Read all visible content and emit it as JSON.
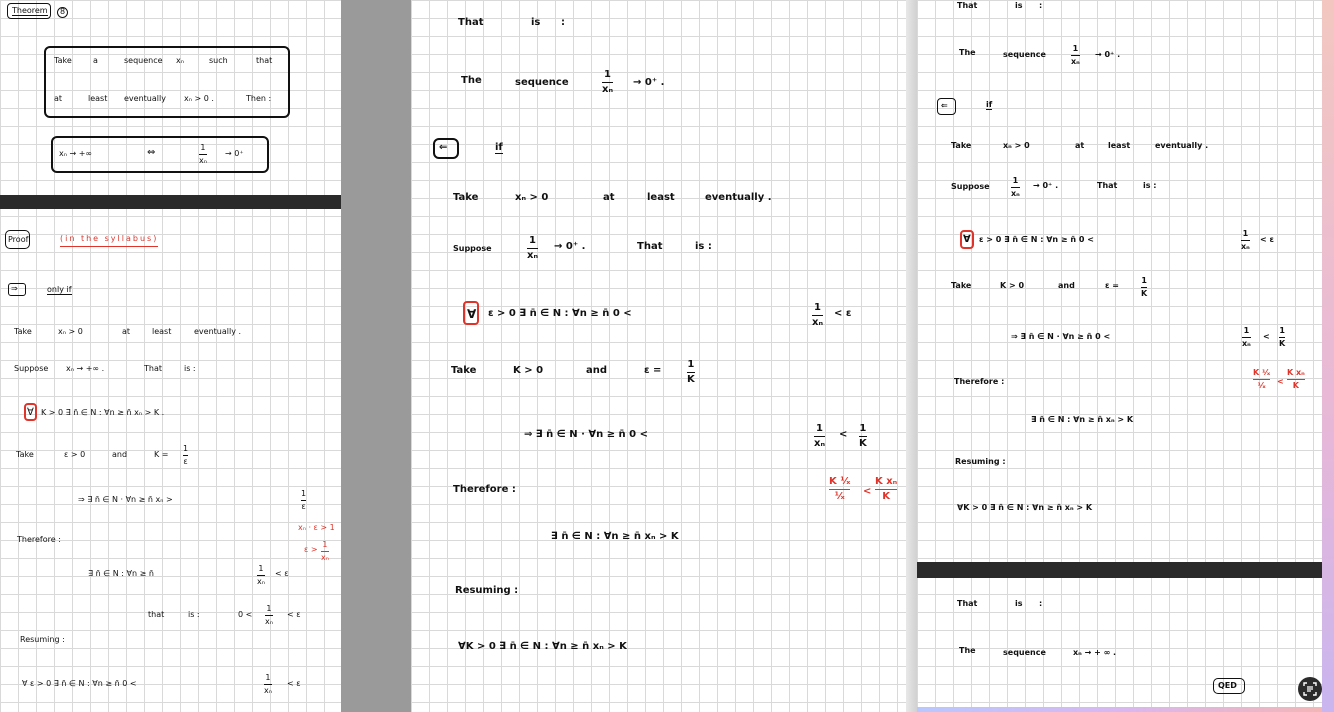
{
  "left": {
    "theorem_label": "Theorem",
    "theorem_num": "8",
    "box1_row1": [
      "Take",
      "a",
      "sequence",
      "xₙ",
      "such",
      "that"
    ],
    "box1_row2": [
      "at",
      "least",
      "eventually",
      "xₙ > 0 .",
      "Then :"
    ],
    "box2_lhs": "xₙ → +∞",
    "box2_iff": "⇔",
    "box2_num": "1",
    "box2_den": "xₙ",
    "box2_rhs": "→ 0⁺",
    "proof_label": "Proof",
    "proof_note": "(in the syllabus)",
    "only_if_arrow": "⇒",
    "only_if_label": "only if",
    "line_take": [
      "Take",
      "xₙ > 0",
      "at",
      "least",
      "eventually ."
    ],
    "line_suppose": [
      "Suppose",
      "xₙ → +∞ .",
      "That",
      "is :"
    ],
    "forall_sym": "∀",
    "line_forall": "K > 0     ∃ n̄ ∈ N  :  ∀n ≥ n̄        xₙ > K .",
    "line_take2": [
      "Take",
      "ε > 0",
      "and",
      "K ="
    ],
    "take2_num": "1",
    "take2_den": "ε",
    "line_imp": "⇒     ∃ n̄ ∈ N  ·  ∀n ≥ n̄        xₙ >",
    "imp_num": "1",
    "imp_den": "ε",
    "red1": "xₙ · ε > 1",
    "red2_pre": "ε >",
    "red2_num": "1",
    "red2_den": "xₙ",
    "therefore": "Therefore :",
    "line_there": "∃ n̄ ∈ N :    ∀n ≥ n̄",
    "there_num": "1",
    "there_den": "xₙ",
    "there_rhs": "< ε",
    "that_is": [
      "that",
      "is :",
      "0 <"
    ],
    "thatis_num": "1",
    "thatis_den": "xₙ",
    "thatis_rhs": "< ε",
    "resuming": "Resuming :",
    "line_resume": "∀ ε > 0     ∃ n̄ ∈ N :    ∀n ≥ n̄          0 <",
    "resume_num": "1",
    "resume_den": "xₙ",
    "resume_rhs": "< ε"
  },
  "mid": {
    "that_is": [
      "That",
      "is",
      ":"
    ],
    "seq": [
      "The",
      "sequence"
    ],
    "seq_num": "1",
    "seq_den": "xₙ",
    "seq_rhs": "→ 0⁺ .",
    "if_arrow": "⇐",
    "if_label": "if",
    "take": [
      "Take",
      "xₙ > 0",
      "at",
      "least",
      "eventually ."
    ],
    "suppose": [
      "Suppose"
    ],
    "sup_num": "1",
    "sup_den": "xₙ",
    "sup_rhs": "→  0⁺ .",
    "sup_tail": [
      "That",
      "is :"
    ],
    "forall_sym": "∀",
    "forall_line": "ε > 0      ∃ n̄ ∈ N  :  ∀n ≥ n̄            0 <",
    "forall_num": "1",
    "forall_den": "xₙ",
    "forall_rhs": "< ε",
    "take2": [
      "Take",
      "K > 0",
      "and",
      "ε ="
    ],
    "take2_num": "1",
    "take2_den": "K",
    "imp_line": "⇒    ∃ n̄ ∈ N  ·  ∀n ≥ n̄          0 <",
    "imp_num1": "1",
    "imp_den1": "xₙ",
    "imp_mid": "<",
    "imp_num2": "1",
    "imp_den2": "K",
    "therefore": "Therefore :",
    "red_left_num": "K ¹⁄ₓ",
    "red_left_den": "¹⁄ₓ",
    "red_lt": "<",
    "red_right_num": "K xₙ",
    "red_right_den": "K",
    "there_line": "∃ n̄ ∈ N :     ∀n ≥ n̄            xₙ > K",
    "resuming": "Resuming :",
    "resume_line": "∀K > 0      ∃ n̄ ∈ N :     ∀n ≥ n̄            xₙ > K"
  },
  "right": {
    "that_is": [
      "That",
      "is",
      ":"
    ],
    "seq": [
      "The",
      "sequence"
    ],
    "seq_num": "1",
    "seq_den": "xₙ",
    "seq_rhs": "→ 0⁺ .",
    "if_arrow": "⇐",
    "if_label": "if",
    "take": [
      "Take",
      "xₙ > 0",
      "at",
      "least",
      "eventually ."
    ],
    "suppose": "Suppose",
    "sup_num": "1",
    "sup_den": "xₙ",
    "sup_rhs": "→ 0⁺ .",
    "sup_tail": [
      "That",
      "is :"
    ],
    "forall_sym": "∀",
    "forall_line": "ε > 0       ∃ n̄ ∈ N  :  ∀n ≥ n̄           0 <",
    "forall_num": "1",
    "forall_den": "xₙ",
    "forall_rhs": "< ε",
    "take2": [
      "Take",
      "K > 0",
      "and",
      "ε ="
    ],
    "take2_num": "1",
    "take2_den": "K",
    "imp_line": "⇒    ∃ n̄ ∈ N  ·  ∀n ≥ n̄          0 <",
    "imp_num1": "1",
    "imp_den1": "xₙ",
    "imp_mid": "<",
    "imp_num2": "1",
    "imp_den2": "K",
    "therefore": "Therefore :",
    "red_a": "K ¹⁄ₓ",
    "red_a_den": "¹⁄ₓ",
    "red_b": "K xₙ",
    "red_b_den": "K",
    "there_line": "∃ n̄ ∈ N :     ∀n ≥ n̄           xₙ > K",
    "resuming": "Resuming :",
    "resume_line": "∀K > 0     ∃ n̄ ∈ N :     ∀n ≥ n̄           xₙ > K",
    "that_is2": [
      "That",
      "is",
      ":"
    ],
    "seq2": [
      "The",
      "sequence",
      "xₙ → + ∞ ."
    ],
    "qed": "QED"
  },
  "fab_icon": "scan-text-icon",
  "accent_red": "#e0342a"
}
